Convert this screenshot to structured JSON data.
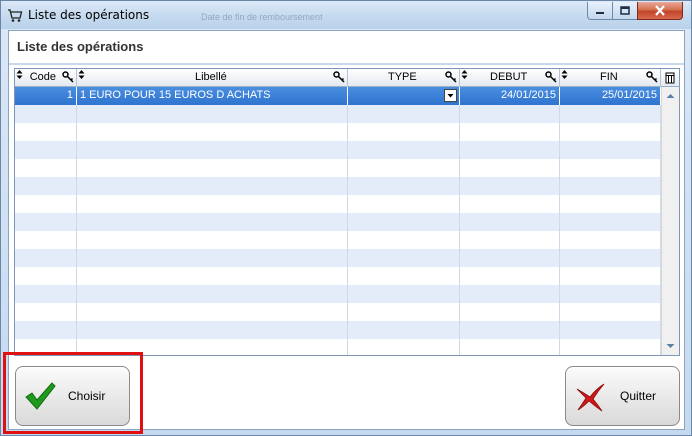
{
  "window": {
    "title": "Liste des opérations",
    "faded_titlebar_texts": [
      "Date de fin de remboursement"
    ]
  },
  "panel": {
    "heading": "Liste des opérations"
  },
  "table": {
    "columns": [
      "Code",
      "Libellé",
      "TYPE",
      "DEBUT",
      "FIN"
    ],
    "rows": [
      {
        "code": "1",
        "libelle": "1 EURO POUR 15 EUROS D ACHATS",
        "type": "",
        "debut": "24/01/2015",
        "fin": "25/01/2015",
        "selected": true
      }
    ],
    "empty_row_count": 14
  },
  "buttons": {
    "choisir": "Choisir",
    "quitter": "Quitter"
  },
  "colors": {
    "selection": "#3479d4",
    "alt_row": "#e3ecf8",
    "highlight_box": "#e01010",
    "check_green": "#1f9a1f",
    "cross_red": "#d01818"
  },
  "icons": [
    "cart-icon",
    "minimize-icon",
    "maximize-icon",
    "close-icon",
    "sort-icon",
    "search-key-icon",
    "dropdown-arrow-icon",
    "scroll-up-icon",
    "scroll-down-icon",
    "column-chooser-icon",
    "checkmark-icon",
    "cross-icon"
  ]
}
